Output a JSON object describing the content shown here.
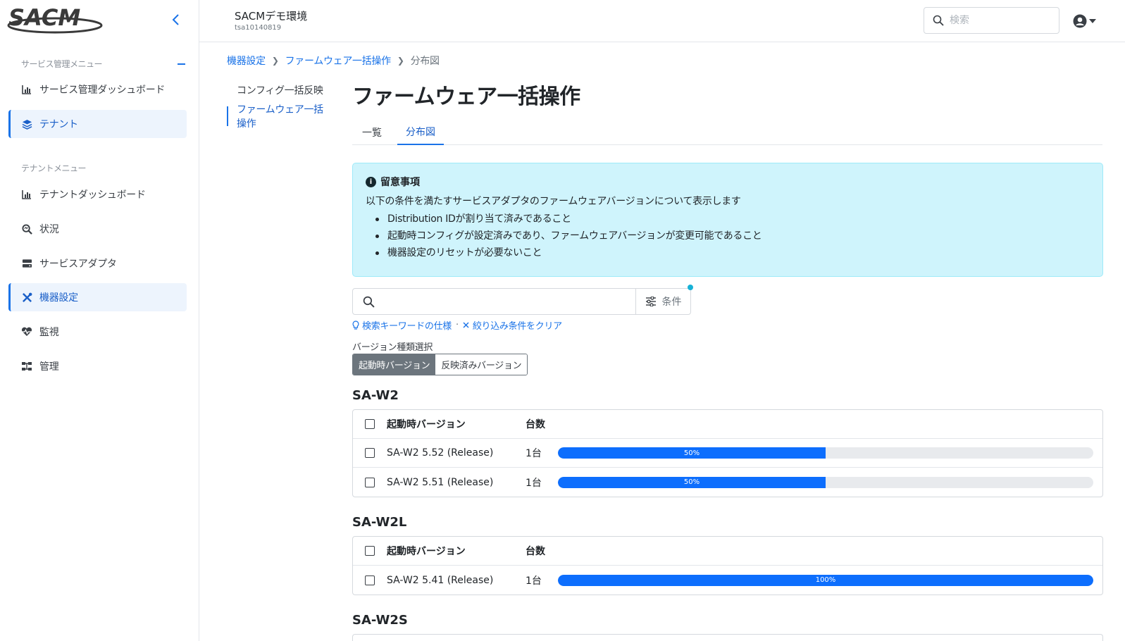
{
  "brand": {
    "logo_text": "SACM"
  },
  "sidebar": {
    "service_section_label": "サービス管理メニュー",
    "tenant_section_label": "テナントメニュー",
    "service_items": [
      {
        "label": "サービス管理ダッシュボード",
        "icon": "bar-chart-icon"
      },
      {
        "label": "テナント",
        "icon": "layers-icon",
        "active": true
      }
    ],
    "tenant_items": [
      {
        "label": "テナントダッシュボード",
        "icon": "bar-chart-icon"
      },
      {
        "label": "状況",
        "icon": "magnifier-icon"
      },
      {
        "label": "サービスアダプタ",
        "icon": "server-icon"
      },
      {
        "label": "機器設定",
        "icon": "tools-icon",
        "active": true
      },
      {
        "label": "監視",
        "icon": "heartbeat-icon"
      },
      {
        "label": "管理",
        "icon": "sitemap-icon"
      }
    ]
  },
  "header": {
    "env_name": "SACMデモ環境",
    "env_id": "tsa10140819",
    "search_placeholder": "検索"
  },
  "breadcrumb": {
    "items": [
      "機器設定",
      "ファームウェア一括操作"
    ],
    "current": "分布図"
  },
  "subnav": {
    "items": [
      "コンフィグ一括反映",
      "ファームウェア一括操作"
    ]
  },
  "page": {
    "title": "ファームウェア一括操作",
    "tabs": [
      "一覧",
      "分布図"
    ]
  },
  "notice": {
    "title": "留意事項",
    "text": "以下の条件を満たすサービスアダプタのファームウェアバージョンについて表示します",
    "items": [
      "Distribution IDが割り当て済みであること",
      "起動時コンフィグが設定済みであり、ファームウェアバージョンが変更可能であること",
      "機器設定のリセットが必要ないこと"
    ]
  },
  "filter": {
    "search_value": "",
    "condition_label": "条件",
    "keyword_spec_link": "検索キーワードの仕様",
    "clear_link": "絞り込み条件をクリア"
  },
  "version_type": {
    "label": "バージョン種類選択",
    "options": [
      "起動時バージョン",
      "反映済みバージョン"
    ],
    "selected": "起動時バージョン"
  },
  "colors": {
    "accent": "#1a73e8",
    "bar": "#0d6efd",
    "notice_bg": "#cff4fc"
  },
  "groups": [
    {
      "name": "SA-W2",
      "col_version": "起動時バージョン",
      "col_count": "台数",
      "rows": [
        {
          "version": "SA-W2 5.52 (Release)",
          "count": "1台",
          "percent": 50,
          "percent_label": "50%"
        },
        {
          "version": "SA-W2 5.51 (Release)",
          "count": "1台",
          "percent": 50,
          "percent_label": "50%"
        }
      ]
    },
    {
      "name": "SA-W2L",
      "col_version": "起動時バージョン",
      "col_count": "台数",
      "rows": [
        {
          "version": "SA-W2 5.41 (Release)",
          "count": "1台",
          "percent": 100,
          "percent_label": "100%"
        }
      ]
    },
    {
      "name": "SA-W2S"
    }
  ]
}
